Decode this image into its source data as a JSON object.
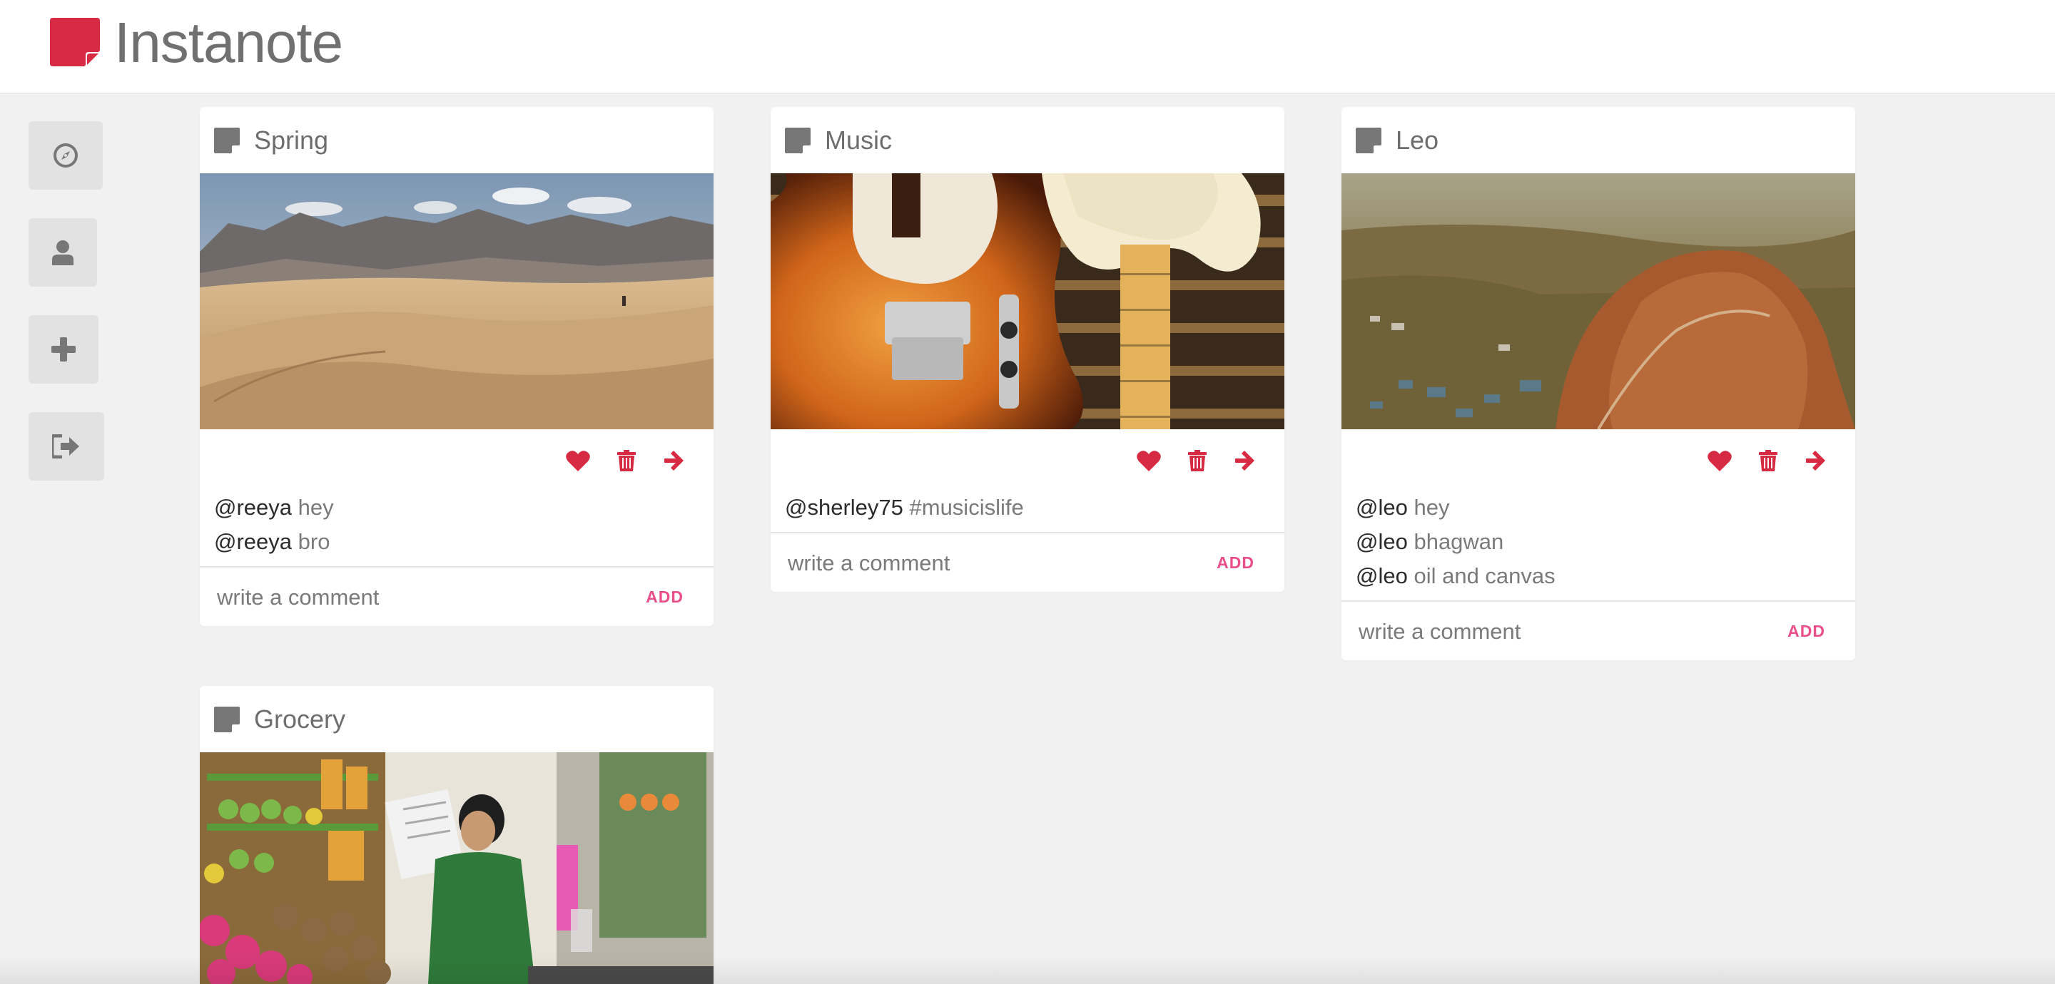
{
  "app": {
    "name": "Instanote",
    "brand_color": "#d72b43"
  },
  "sidebar": {
    "items": [
      {
        "name": "explore",
        "icon": "compass-icon"
      },
      {
        "name": "profile",
        "icon": "user-icon"
      },
      {
        "name": "add",
        "icon": "plus-icon"
      },
      {
        "name": "logout",
        "icon": "sign-out-icon"
      }
    ]
  },
  "notes": [
    {
      "title": "Spring",
      "image": "desert-dunes-photo",
      "comments": [
        {
          "user": "@reeya",
          "text": " hey"
        },
        {
          "user": "@reeya",
          "text": " bro"
        }
      ],
      "comment_placeholder": "write a comment",
      "add_label": "ADD"
    },
    {
      "title": "Music",
      "image": "guitars-photo",
      "comments": [
        {
          "user": "@sherley75",
          "text": " #musicislife"
        }
      ],
      "comment_placeholder": "write a comment",
      "add_label": "ADD"
    },
    {
      "title": "Leo",
      "image": "aerial-hill-photo",
      "comments": [
        {
          "user": "@leo",
          "text": " hey"
        },
        {
          "user": "@leo",
          "text": " bhagwan"
        },
        {
          "user": "@leo",
          "text": " oil and canvas"
        }
      ],
      "comment_placeholder": "write a comment",
      "add_label": "ADD"
    },
    {
      "title": "Grocery",
      "image": "market-stall-photo"
    }
  ],
  "colors": {
    "action_red": "#d72b43",
    "add_pink": "#ec4e8a",
    "background": "#f1f1f1"
  }
}
